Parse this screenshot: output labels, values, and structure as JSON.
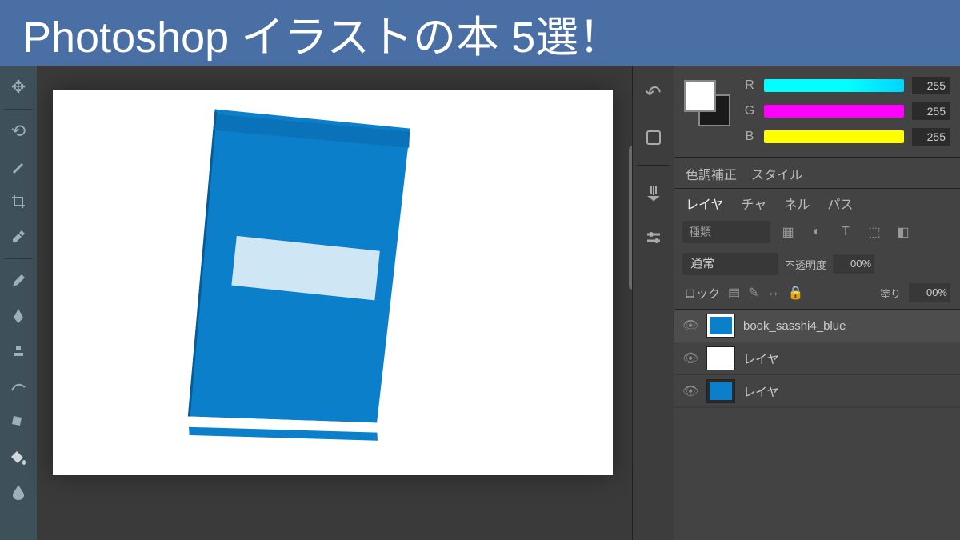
{
  "header": {
    "title": "Photoshop イラストの本 5選！"
  },
  "color": {
    "r": {
      "label": "R",
      "value": "255"
    },
    "g": {
      "label": "G",
      "value": "255"
    },
    "b": {
      "label": "B",
      "value": "255"
    }
  },
  "tabs1": {
    "t1": "色調補正",
    "t2": "スタイル"
  },
  "tabs2": {
    "t1": "レイヤ",
    "t2": "チャ",
    "t3": "ネル",
    "t4": "パス"
  },
  "search": {
    "label": "種類"
  },
  "blend": {
    "mode": "通常",
    "opacity_label": "不透明度",
    "opacity_value": "00%"
  },
  "lock": {
    "label": "ロック",
    "fill_label": "塗り",
    "fill_value": "00%"
  },
  "layers": [
    {
      "name": "book_sasshi4_blue"
    },
    {
      "name": "レイヤ"
    },
    {
      "name": "レイヤ"
    }
  ]
}
